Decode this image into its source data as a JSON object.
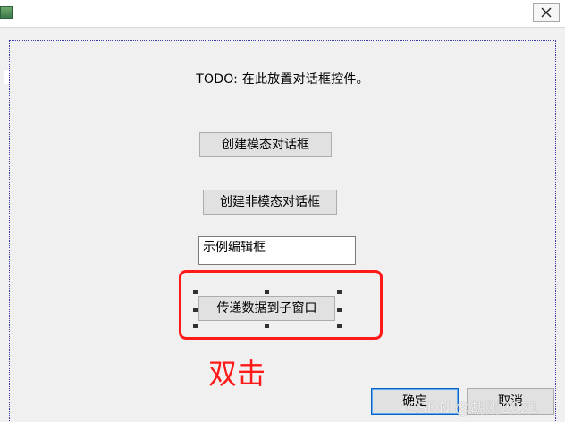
{
  "colors": {
    "accent_red": "#ff1a1a",
    "default_button_border": "#0a64c8",
    "dialog_bg": "#f0f0f0",
    "app_icon_green": "#4f8f5a"
  },
  "titlebar": {
    "app_icon": "app-icon",
    "close_icon": "close-icon"
  },
  "dialog": {
    "todo_text": "TODO: 在此放置对话框控件。",
    "buttons": {
      "create_modal": "创建模态对话框",
      "create_modeless": "创建非模态对话框",
      "pass_data": "传递数据到子窗口",
      "ok": "确定",
      "cancel": "取消"
    },
    "edit": {
      "value": "示例编辑框"
    }
  },
  "annotation": {
    "label": "双击"
  },
  "watermark": {
    "text": "CSDN @胡刚2021"
  }
}
